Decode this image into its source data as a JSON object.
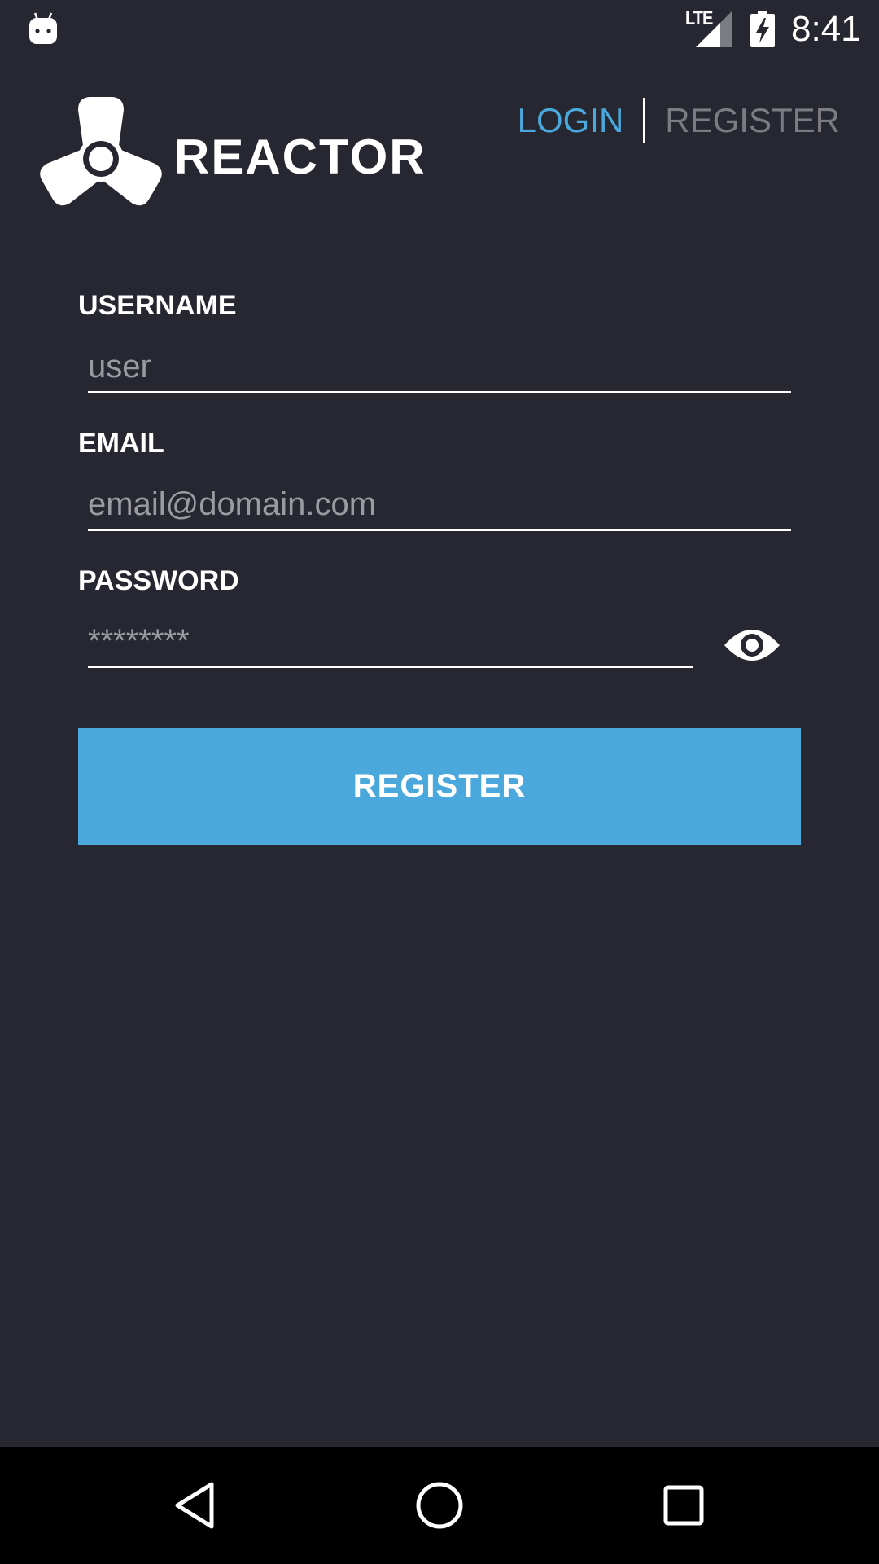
{
  "status_bar": {
    "network_label": "LTE",
    "time": "8:41",
    "icons": [
      "android-icon",
      "signal-icon",
      "battery-charging-icon"
    ]
  },
  "header": {
    "brand": "REACTOR",
    "logo_icon": "reactor-logo-icon",
    "tabs": [
      {
        "label": "LOGIN",
        "active": true
      },
      {
        "label": "REGISTER",
        "active": false
      }
    ]
  },
  "form": {
    "username": {
      "label": "USERNAME",
      "placeholder": "user",
      "value": ""
    },
    "email": {
      "label": "EMAIL",
      "placeholder": "email@domain.com",
      "value": ""
    },
    "password": {
      "label": "PASSWORD",
      "placeholder": "********",
      "value": "",
      "toggle_icon": "eye-icon"
    },
    "submit_label": "REGISTER"
  },
  "nav_bar": {
    "icons": [
      "back-icon",
      "home-icon",
      "recents-icon"
    ]
  },
  "colors": {
    "background": "#262730",
    "accent": "#4aa8dc",
    "inactive_tab": "#7b7c82",
    "placeholder": "#9a9ba1",
    "nav_bar": "#000000"
  }
}
